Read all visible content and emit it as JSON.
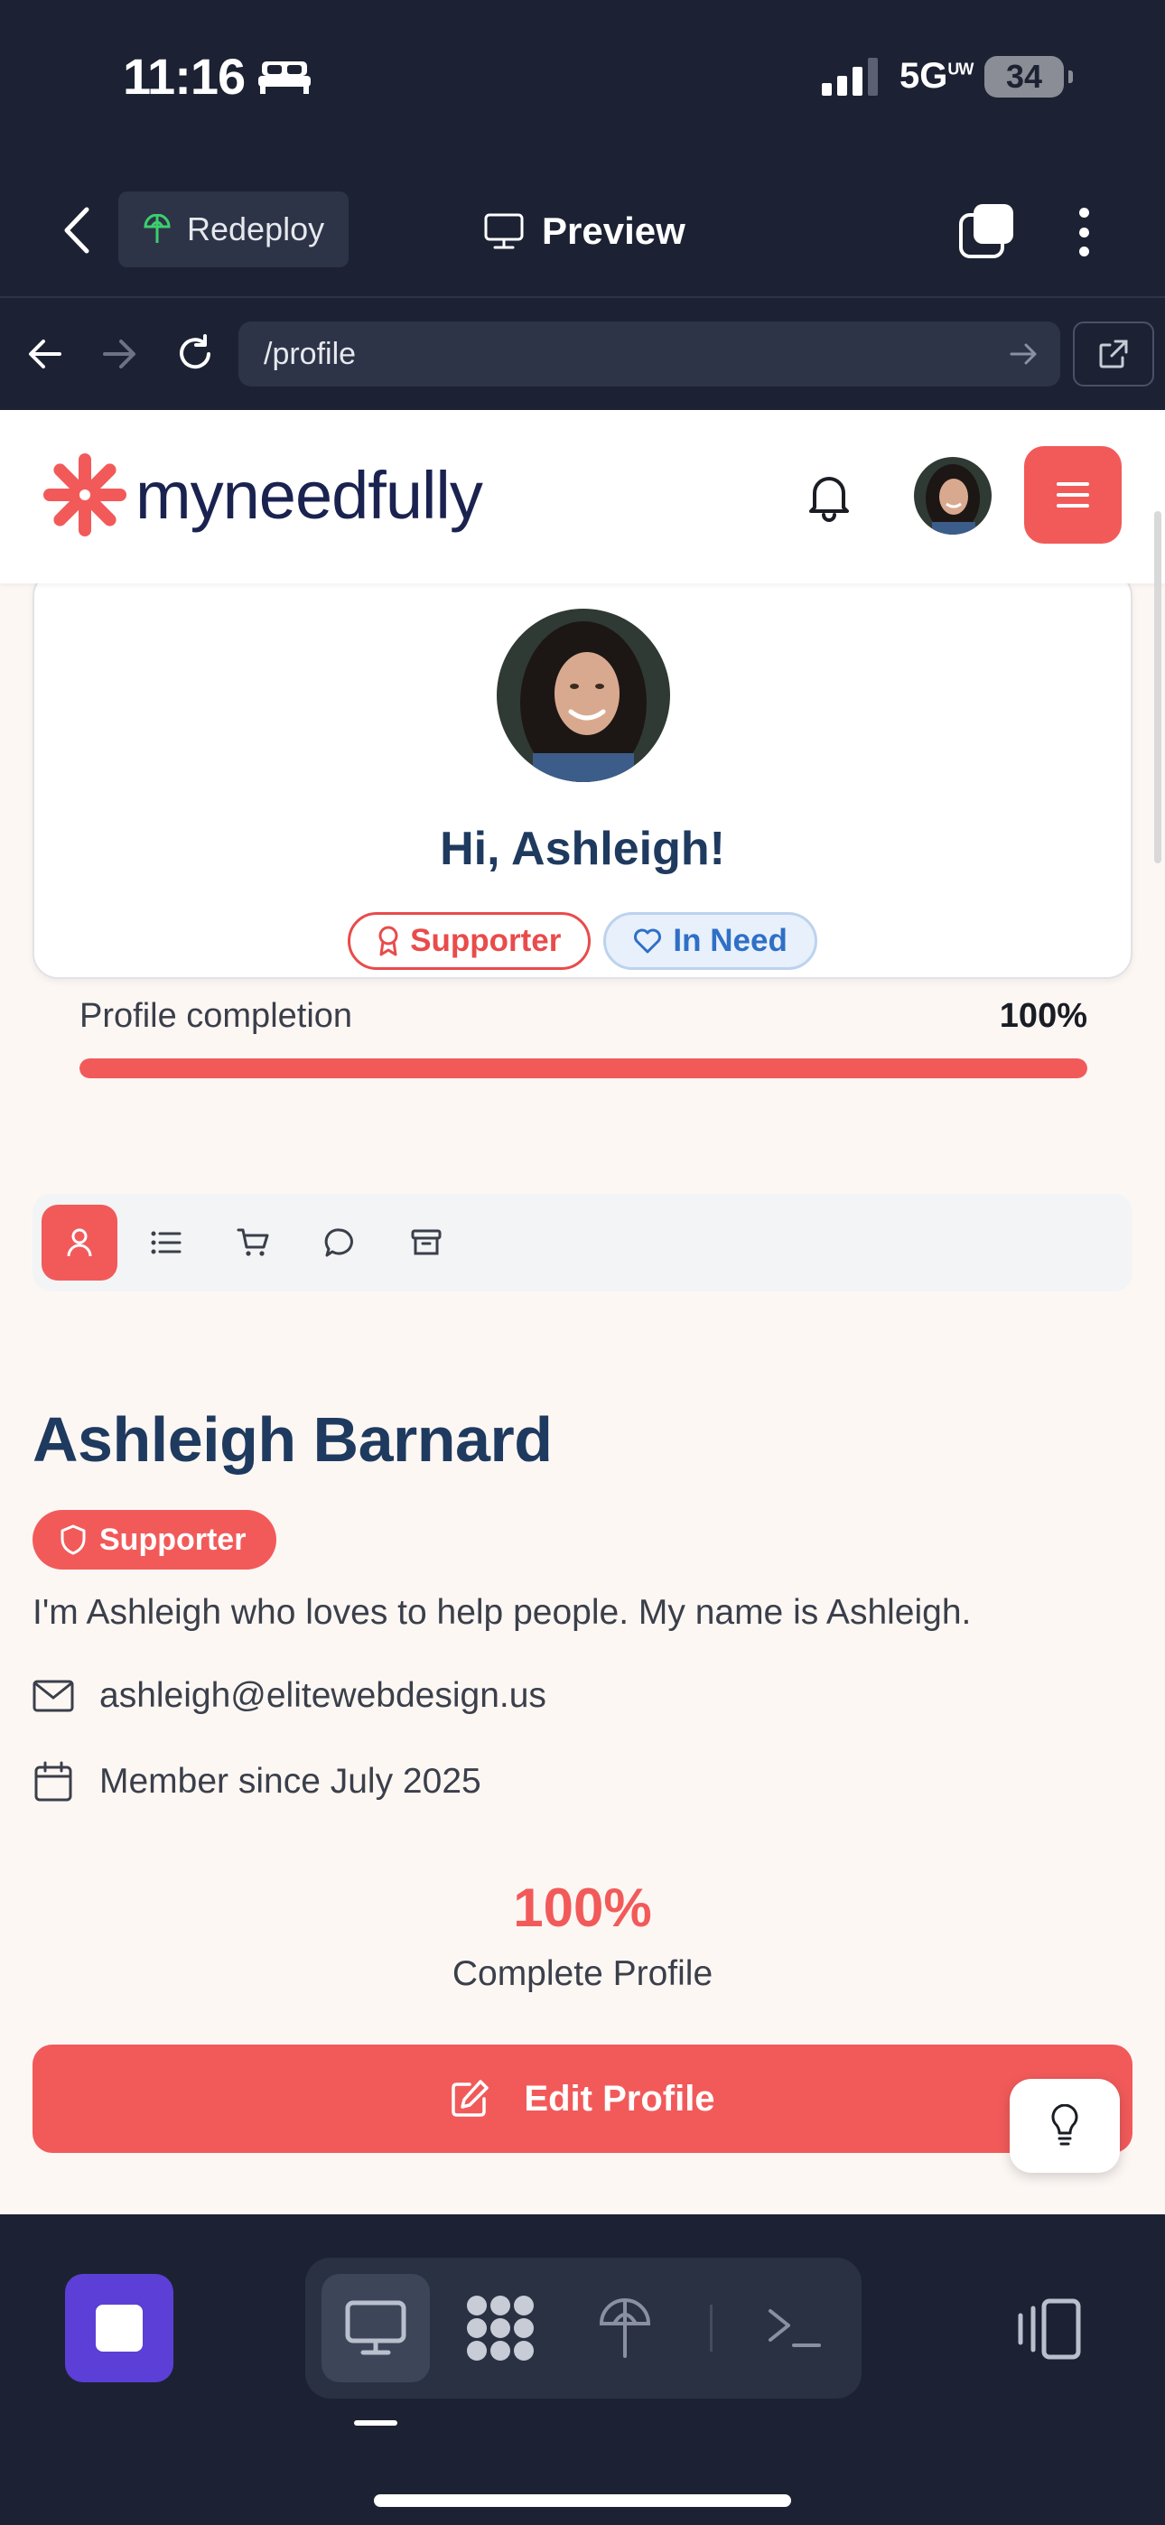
{
  "status_bar": {
    "time": "11:16",
    "network": "5G",
    "network_suffix": "UW",
    "battery": "34"
  },
  "app_toolbar": {
    "redeploy_label": "Redeploy",
    "preview_label": "Preview"
  },
  "browser": {
    "url": "/profile"
  },
  "site": {
    "logo_text": "myneedfully"
  },
  "profile_card": {
    "greeting": "Hi, Ashleigh!",
    "badges": [
      "Supporter",
      "In Need"
    ],
    "completion_label": "Profile completion",
    "completion_value": "100%",
    "completion_fraction": 1.0
  },
  "profile_tabs": [
    "user-icon",
    "list-icon",
    "cart-icon",
    "chat-icon",
    "archive-icon"
  ],
  "profile": {
    "name": "Ashleigh Barnard",
    "role": "Supporter",
    "bio": "I'm Ashleigh who loves to help people. My name is Ashleigh.",
    "email": "ashleigh@elitewebdesign.us",
    "member_since": "Member since July 2025",
    "completion_percent": "100%",
    "completion_caption": "Complete Profile",
    "edit_label": "Edit Profile"
  },
  "colors": {
    "accent": "#f25a5a",
    "navy": "#1f3a5f",
    "chrome": "#1c2233",
    "stop": "#5b3fd6"
  }
}
